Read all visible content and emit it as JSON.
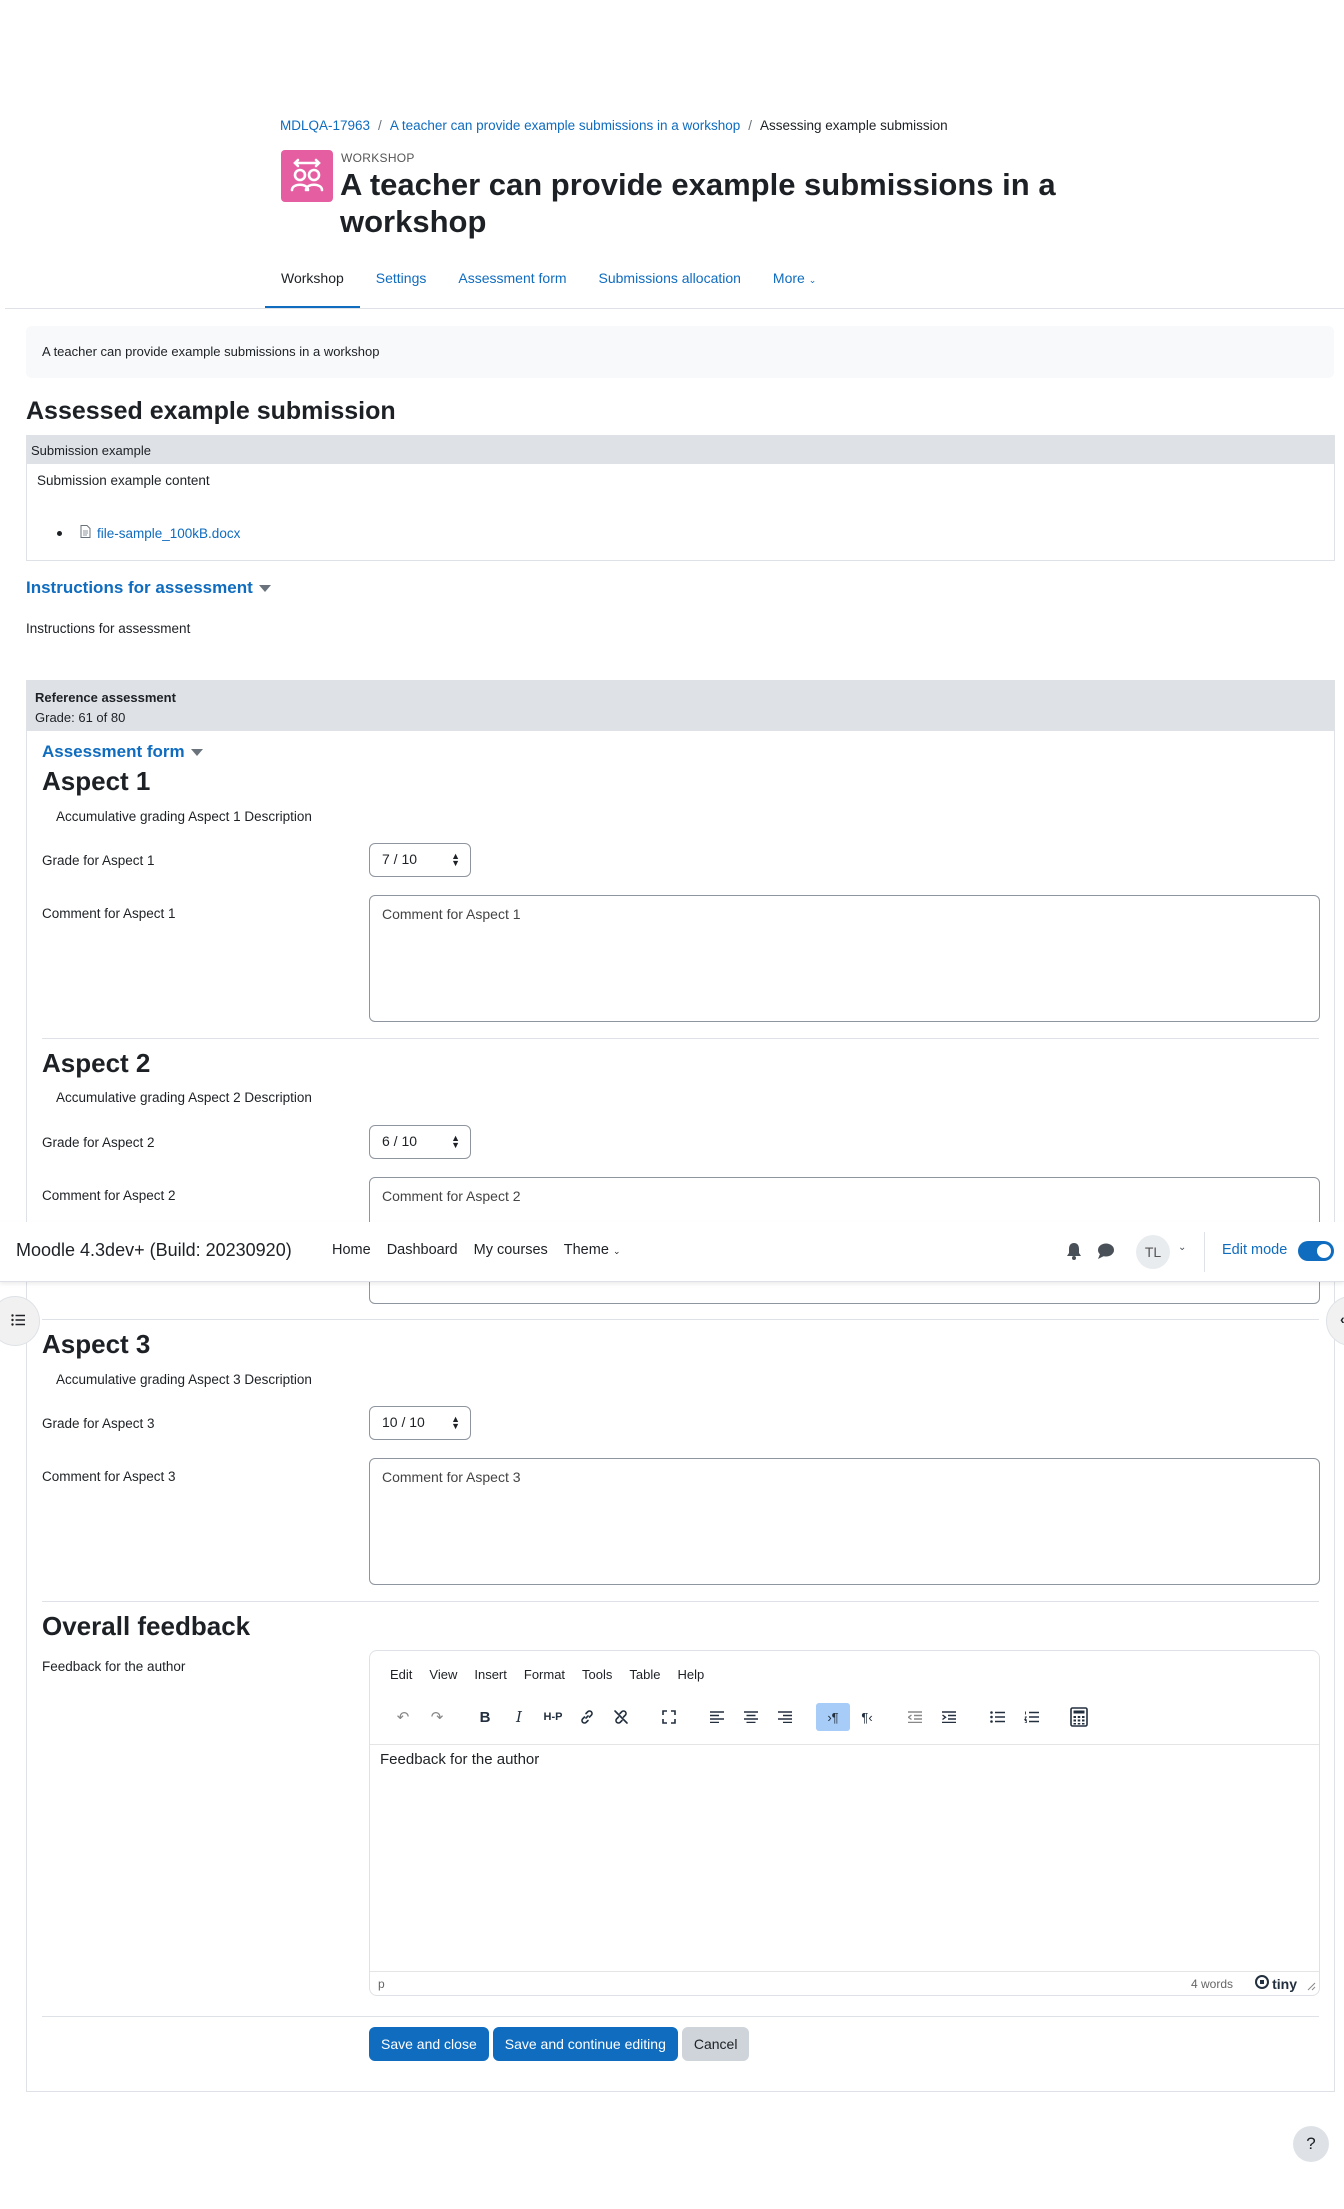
{
  "breadcrumb": {
    "items": [
      "MDLQA-17963",
      "A teacher can provide example submissions in a workshop"
    ],
    "current": "Assessing example submission",
    "separator": "/"
  },
  "header": {
    "pre_title": "WORKSHOP",
    "title": "A teacher can provide example submissions in a workshop",
    "icon": "workshop-icon",
    "icon_color": "#e55ea1"
  },
  "secondary_nav": {
    "tabs": [
      "Workshop",
      "Settings",
      "Assessment form",
      "Submissions allocation",
      "More"
    ],
    "active": "Workshop"
  },
  "intro": "A teacher can provide example submissions in a workshop",
  "submission": {
    "heading": "Assessed example submission",
    "title": "Submission example",
    "content": "Submission example content",
    "file": "file-sample_100kB.docx"
  },
  "instructions": {
    "toggle": "Instructions for assessment",
    "text": "Instructions for assessment"
  },
  "reference": {
    "title": "Reference assessment",
    "grade": "Grade: 61 of 80",
    "form_toggle": "Assessment form"
  },
  "aspects": [
    {
      "title": "Aspect 1",
      "description": "Accumulative grading Aspect 1 Description",
      "grade_label": "Grade for Aspect 1",
      "grade": "7 / 10",
      "comment_label": "Comment for Aspect 1",
      "comment_placeholder": "Comment for Aspect 1"
    },
    {
      "title": "Aspect 2",
      "description": "Accumulative grading Aspect 2 Description",
      "grade_label": "Grade for Aspect 2",
      "grade": "6 / 10",
      "comment_label": "Comment for Aspect 2",
      "comment_placeholder": "Comment for Aspect 2"
    },
    {
      "title": "Aspect 3",
      "description": "Accumulative grading Aspect 3 Description",
      "grade_label": "Grade for Aspect 3",
      "grade": "10 / 10",
      "comment_label": "Comment for Aspect 3",
      "comment_placeholder": "Comment for Aspect 3"
    }
  ],
  "feedback": {
    "heading": "Overall feedback",
    "label": "Feedback for the author",
    "content": "Feedback for the author",
    "editor_menu": [
      "Edit",
      "View",
      "Insert",
      "Format",
      "Tools",
      "Table",
      "Help"
    ],
    "status_path": "p",
    "word_count": "4 words",
    "brand": "tiny"
  },
  "buttons": {
    "save_close": "Save and close",
    "save_continue": "Save and continue editing",
    "cancel": "Cancel"
  },
  "navbar": {
    "brand": "Moodle 4.3dev+ (Build: 20230920)",
    "menu": [
      "Home",
      "Dashboard",
      "My courses",
      "Theme"
    ],
    "avatar": "TL",
    "edit_mode": "Edit mode",
    "edit_mode_on": true
  },
  "help": "?",
  "colors": {
    "primary": "#0f6cbf",
    "accent_pink": "#e55ea1",
    "header_gray": "#dee2e6"
  }
}
